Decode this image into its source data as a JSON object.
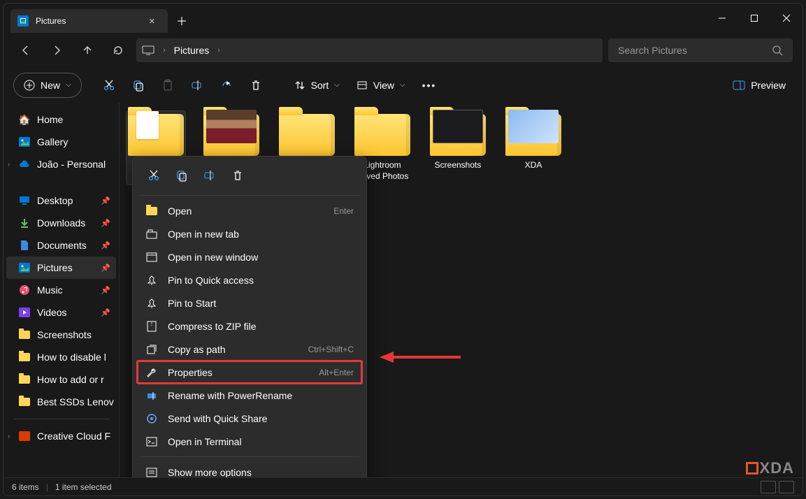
{
  "tab": {
    "title": "Pictures"
  },
  "breadcrumb": {
    "segments": [
      "Pictures"
    ]
  },
  "search": {
    "placeholder": "Search Pictures"
  },
  "toolbar": {
    "new": "New",
    "sort": "Sort",
    "view": "View",
    "preview": "Preview"
  },
  "sidebar": {
    "home": "Home",
    "gallery": "Gallery",
    "personal": "João - Personal",
    "desktop": "Desktop",
    "downloads": "Downloads",
    "documents": "Documents",
    "pictures": "Pictures",
    "music": "Music",
    "videos": "Videos",
    "screenshots": "Screenshots",
    "howto_disable": "How to disable l",
    "howto_add": "How to add or r",
    "best_ssds": "Best SSDs Lenov",
    "creative_cloud": "Creative Cloud F"
  },
  "items": [
    {
      "name": ""
    },
    {
      "name": ""
    },
    {
      "name": ""
    },
    {
      "name": "Lightroom Saved Photos"
    },
    {
      "name": "Screenshots"
    },
    {
      "name": "XDA"
    }
  ],
  "context_menu": {
    "open": {
      "label": "Open",
      "shortcut": "Enter"
    },
    "open_new_tab": {
      "label": "Open in new tab"
    },
    "open_new_window": {
      "label": "Open in new window"
    },
    "pin_quick": {
      "label": "Pin to Quick access"
    },
    "pin_start": {
      "label": "Pin to Start"
    },
    "compress": {
      "label": "Compress to ZIP file"
    },
    "copy_path": {
      "label": "Copy as path",
      "shortcut": "Ctrl+Shift+C"
    },
    "properties": {
      "label": "Properties",
      "shortcut": "Alt+Enter"
    },
    "rename_power": {
      "label": "Rename with PowerRename"
    },
    "quick_share": {
      "label": "Send with Quick Share"
    },
    "terminal": {
      "label": "Open in Terminal"
    },
    "more": {
      "label": "Show more options"
    }
  },
  "status": {
    "count": "6 items",
    "selected": "1 item selected"
  },
  "watermark": "XDA"
}
